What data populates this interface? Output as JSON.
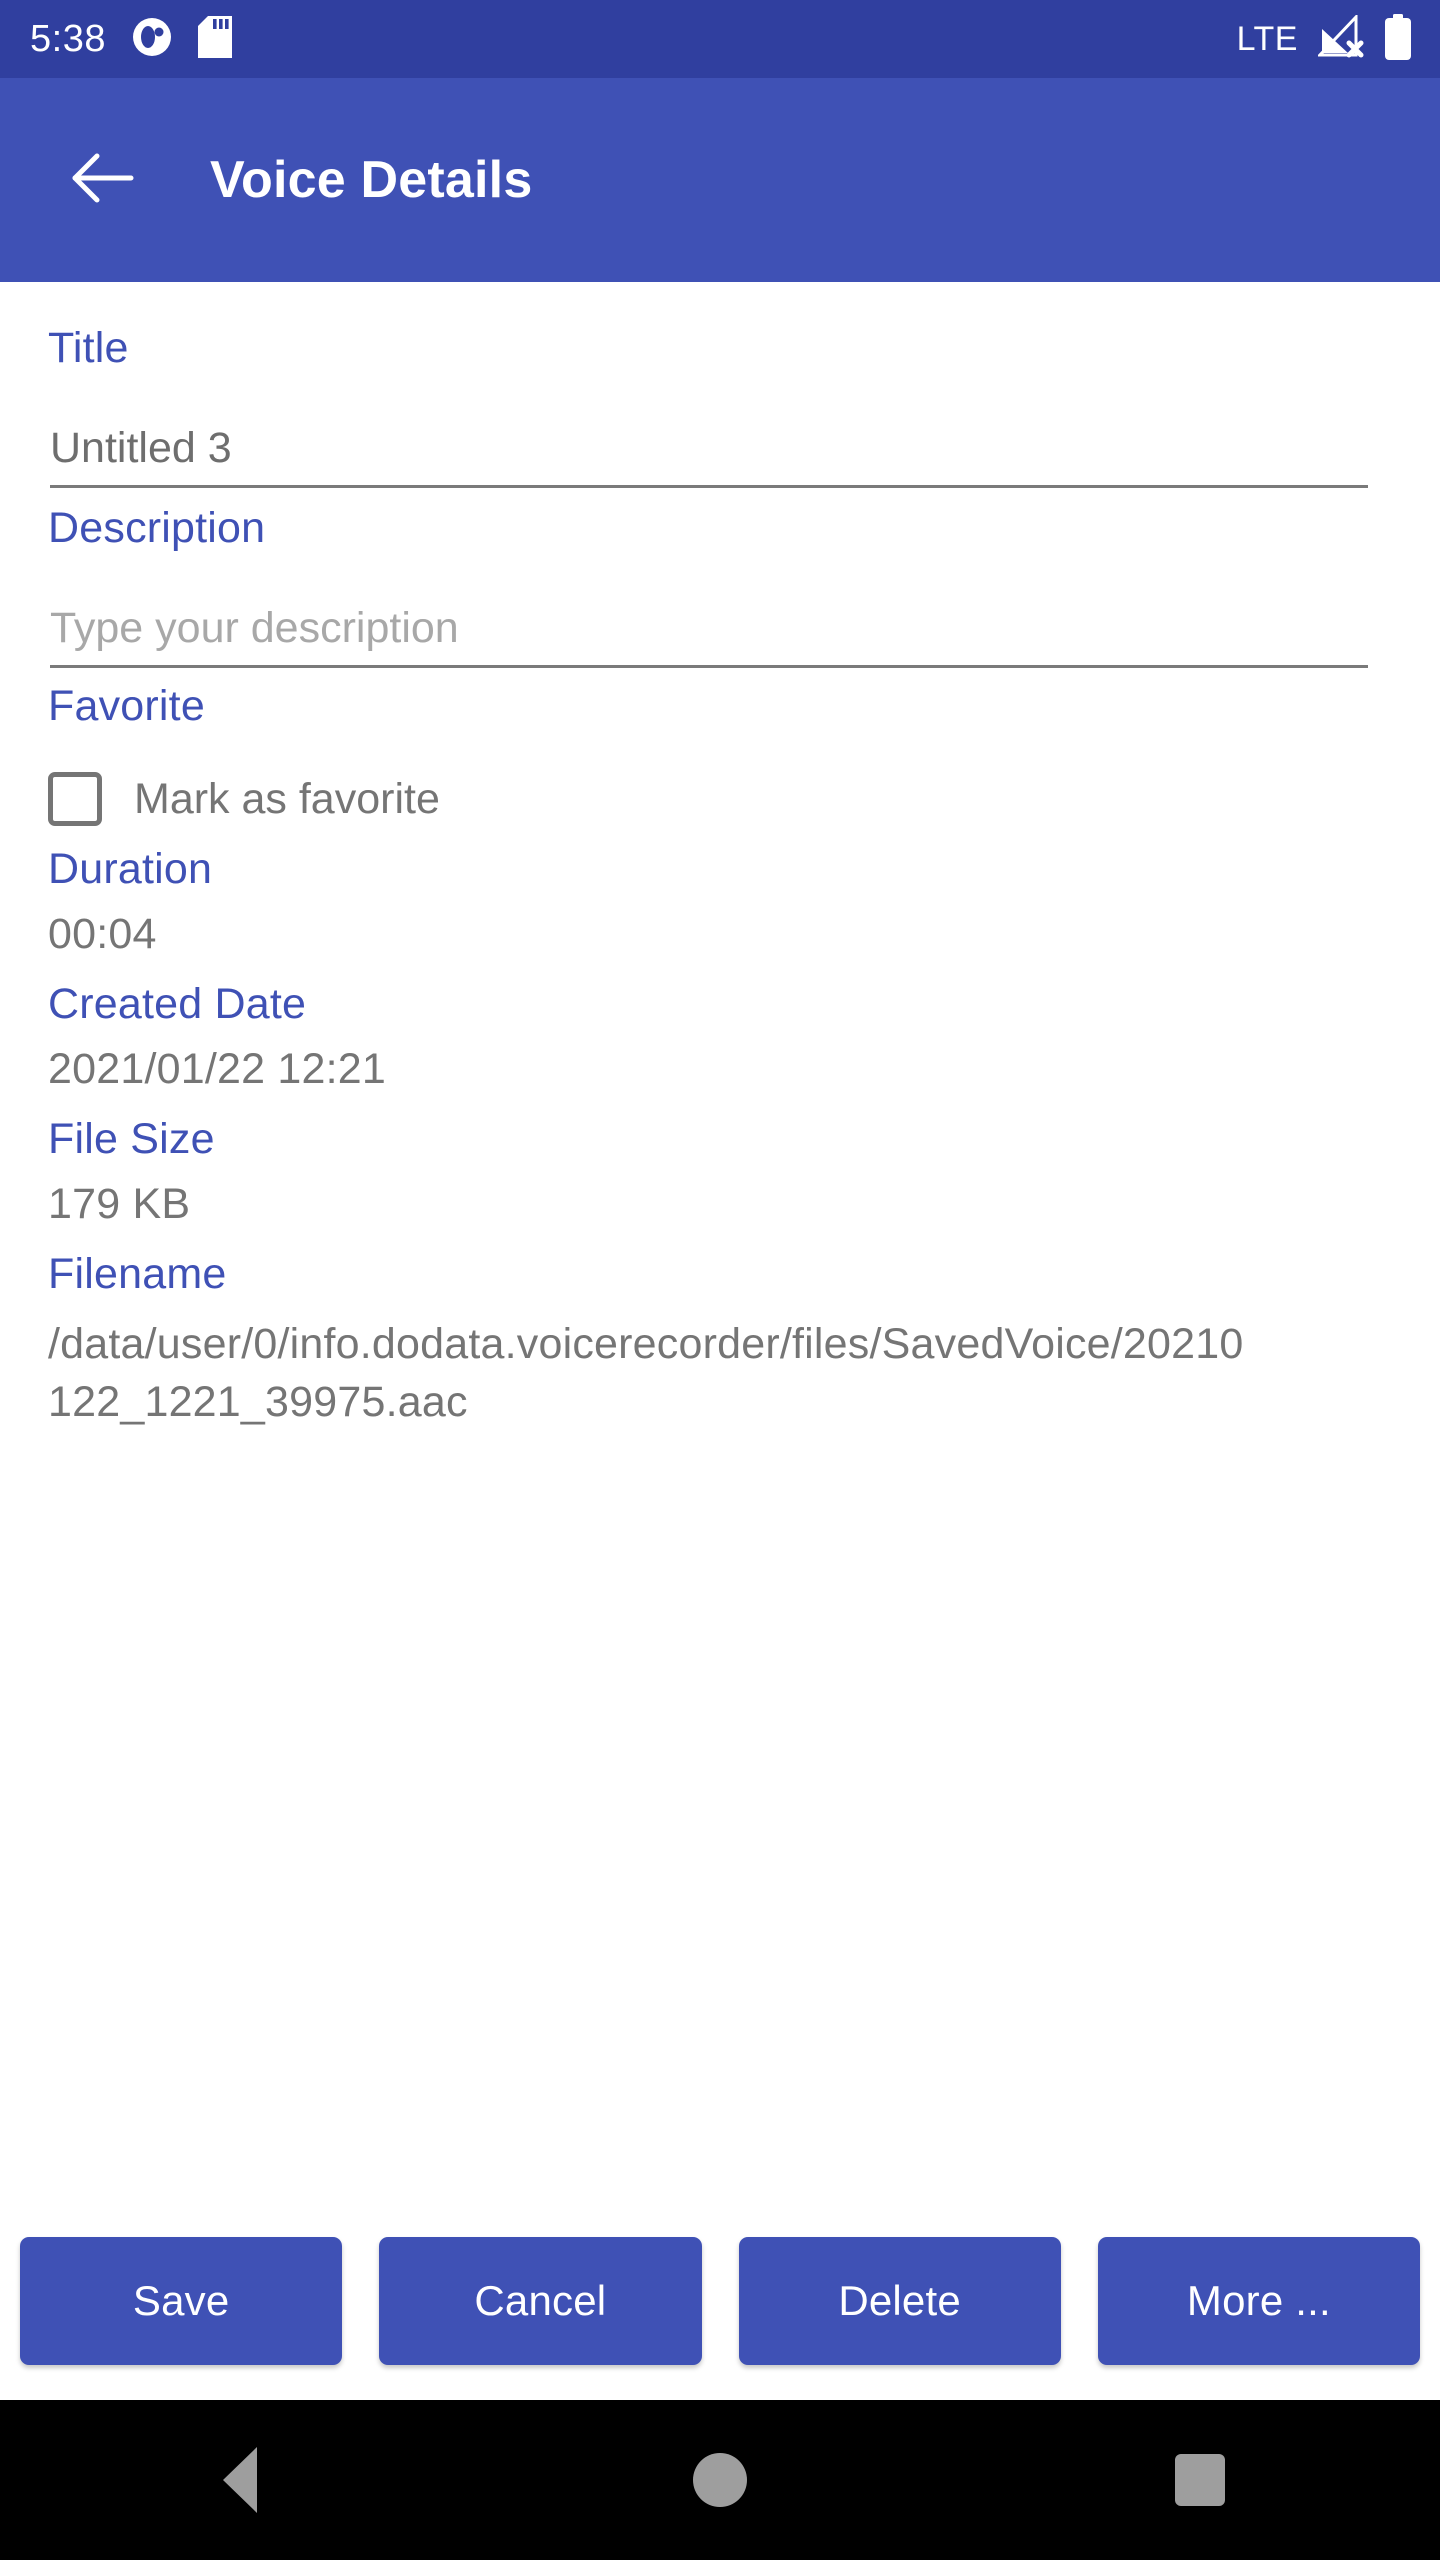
{
  "status_bar": {
    "clock": "5:38",
    "network_label": "LTE",
    "icons": [
      "app-notification-icon",
      "sd-card-icon",
      "signal-no-service-icon",
      "battery-full-icon"
    ],
    "background_color": "#303F9F"
  },
  "app_bar": {
    "title": "Voice Details",
    "back_icon": "arrow-left-icon",
    "background_color": "#3F51B5",
    "title_color": "#FFFFFF"
  },
  "form": {
    "label_color": "#3F51B5",
    "value_color": "#757575",
    "title": {
      "label": "Title",
      "value": "Untitled 3",
      "placeholder": "Title"
    },
    "description": {
      "label": "Description",
      "value": "",
      "placeholder": "Type your description"
    },
    "favorite": {
      "label": "Favorite",
      "checkbox_label": "Mark as favorite",
      "checked": false
    },
    "duration": {
      "label": "Duration",
      "value": "00:04"
    },
    "created_date": {
      "label": "Created Date",
      "value": "2021/01/22 12:21"
    },
    "file_size": {
      "label": "File Size",
      "value": "179 KB"
    },
    "filename": {
      "label": "Filename",
      "value": "/data/user/0/info.dodata.voicerecorder/files/SavedVoice/20210122_1221_39975.aac"
    }
  },
  "buttons": {
    "save": "Save",
    "cancel": "Cancel",
    "delete": "Delete",
    "more": "More ...",
    "background_color": "#3F51B5"
  },
  "nav_bar": {
    "back": "back-triangle-icon",
    "home": "home-circle-icon",
    "recents": "recents-square-icon",
    "background_color": "#000000"
  }
}
